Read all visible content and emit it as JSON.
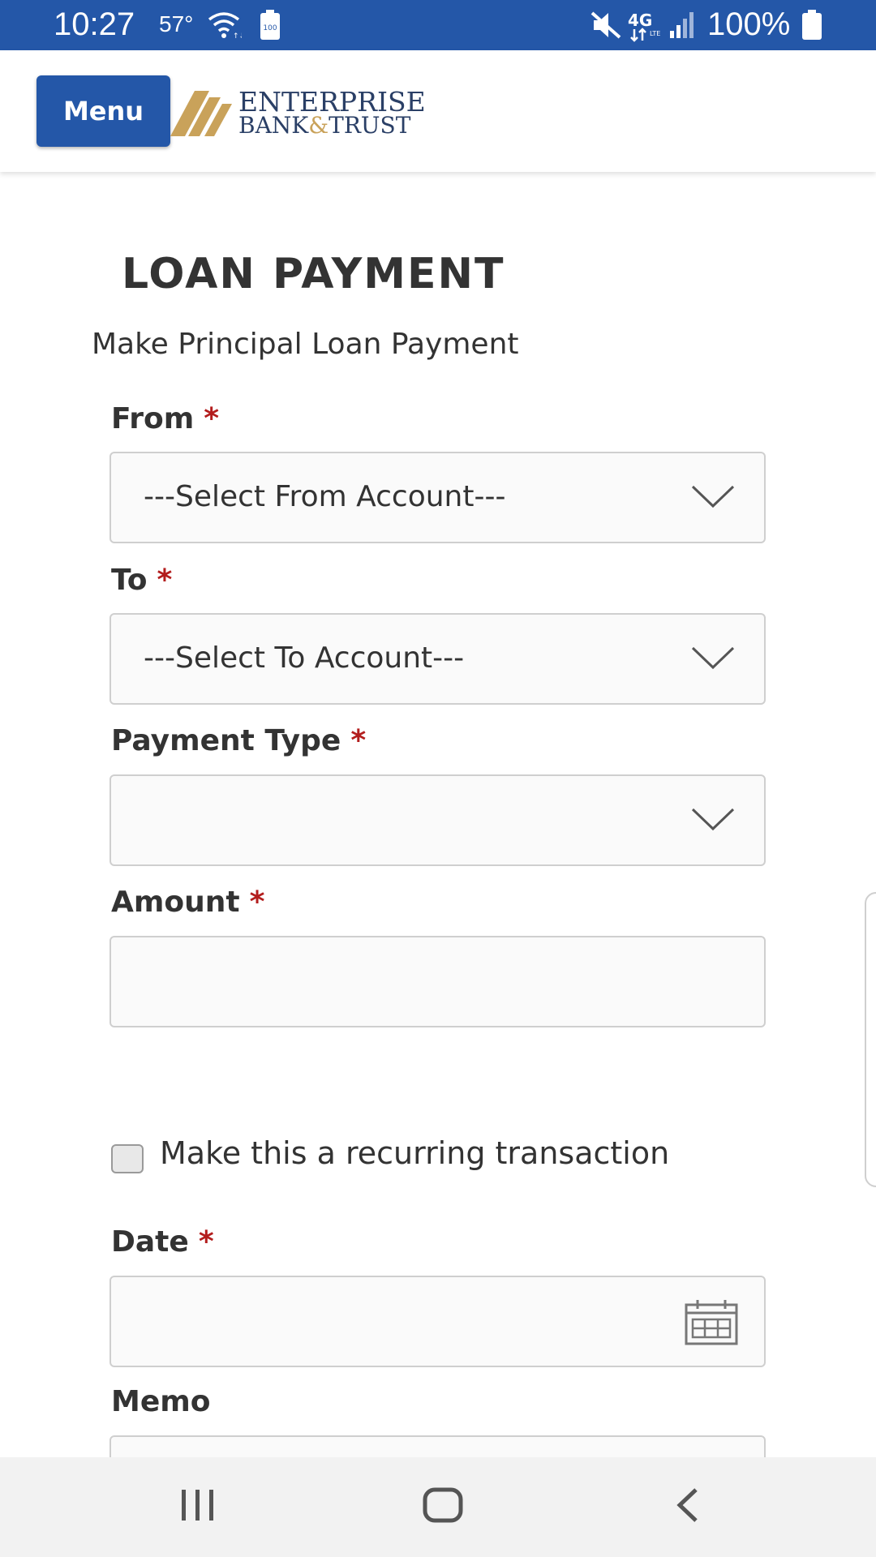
{
  "status_bar": {
    "time": "10:27",
    "temperature": "57°",
    "battery": "100%",
    "icons": [
      "wifi-icon",
      "battery-saver-icon",
      "mute-icon",
      "4g-lte-icon",
      "signal-icon",
      "battery-icon"
    ]
  },
  "header": {
    "menu_label": "Menu",
    "logo": {
      "line1": "ENTERPRISE",
      "line2_a": "BANK",
      "line2_amp": "&",
      "line2_b": "TRUST"
    }
  },
  "page": {
    "title": "LOAN PAYMENT",
    "subtitle": "Make Principal Loan Payment"
  },
  "form": {
    "required_mark": "*",
    "from": {
      "label": "From",
      "value": "---Select From Account---"
    },
    "to": {
      "label": "To",
      "value": "---Select To Account---"
    },
    "payment_type": {
      "label": "Payment Type",
      "value": ""
    },
    "amount": {
      "label": "Amount",
      "value": ""
    },
    "recurring": {
      "label": "Make this a recurring transaction",
      "checked": false
    },
    "date": {
      "label": "Date",
      "value": ""
    },
    "memo": {
      "label": "Memo",
      "value": ""
    }
  },
  "colors": {
    "brand_blue": "#2457a8",
    "required_red": "#b31d1d",
    "logo_gold": "#c9a25a",
    "logo_navy": "#2a3f66"
  },
  "nav_bar": {
    "icons": [
      "recents-icon",
      "home-icon",
      "back-icon"
    ]
  }
}
